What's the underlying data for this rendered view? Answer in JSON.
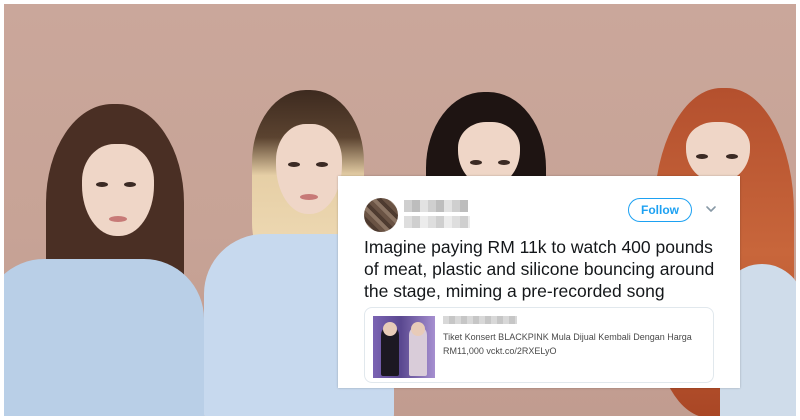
{
  "tweet": {
    "follow_label": "Follow",
    "text": "Imagine paying RM 11k to watch 400 pounds of meat, plastic and silicone bouncing around the stage, miming a pre-recorded song",
    "card": {
      "description": "Tiket Konsert BLACKPINK Mula Dijual Kembali Dengan Harga RM11,000 vckt.co/2RXELyO"
    }
  },
  "colors": {
    "accent": "#1da1f2",
    "text": "#14171a",
    "background": "#c9a597"
  },
  "icons": {
    "menu": "chevron-down-icon"
  }
}
